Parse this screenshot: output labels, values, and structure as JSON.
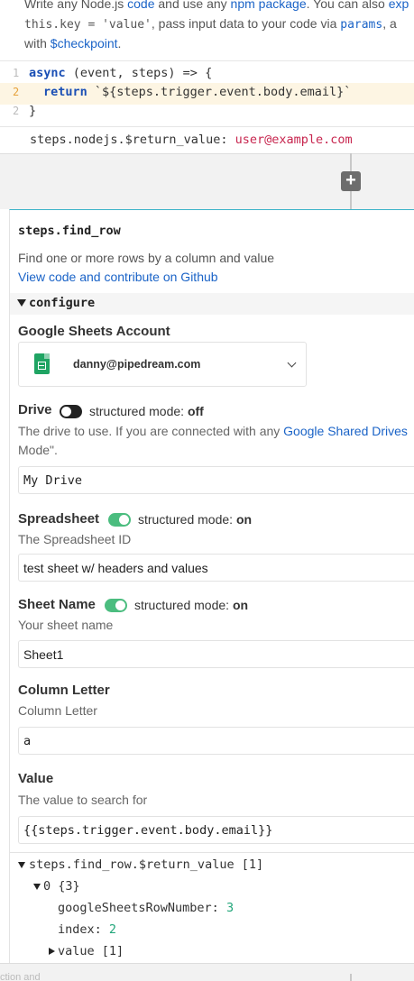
{
  "top_description": {
    "line1_part1": "Write any Node.js ",
    "line1_link1": "code",
    "line1_part2": " and use any ",
    "line1_link2": "npm package",
    "line1_part3": ". You can also ",
    "line1_link3": "exp",
    "line2_code1": "this.key = 'value'",
    "line2_part1": ", pass input data to your code via ",
    "line2_link1": "params",
    "line2_part2": ", a",
    "line3_part1": "with ",
    "line3_link1": "$checkpoint",
    "line3_part2": "."
  },
  "editor": {
    "line_numbers": [
      "1",
      "2",
      "2"
    ],
    "line1_kw": "async",
    "line1_rest": " (event, steps) => {",
    "line2_kw": "return",
    "line2_rest": " `${steps.trigger.event.body.email}`",
    "line3": "}"
  },
  "previous_return": {
    "label": "steps.nodejs.$return_value: ",
    "value": "user@example.com"
  },
  "add_step_symbol": "+",
  "step": {
    "title": "steps.find_row",
    "description": "Find one or more rows by a column and value",
    "github_link": "View code and contribute on Github",
    "configure_label": "configure",
    "account": {
      "label": "Google Sheets Account",
      "email": "danny@pipedream.com"
    },
    "drive": {
      "label": "Drive",
      "mode_prefix": "structured mode: ",
      "mode_value": "off",
      "desc_part1": "The drive to use. If you are connected with any ",
      "desc_link": "Google Shared Drives",
      "desc_line2": "Mode\".",
      "value": "My Drive"
    },
    "spreadsheet": {
      "label": "Spreadsheet",
      "mode_prefix": "structured mode: ",
      "mode_value": "on",
      "desc": "The Spreadsheet ID",
      "value": "test sheet w/ headers and values"
    },
    "sheet_name": {
      "label": "Sheet Name",
      "mode_prefix": "structured mode: ",
      "mode_value": "on",
      "desc": "Your sheet name",
      "value": "Sheet1"
    },
    "column": {
      "label": "Column Letter",
      "desc": "Column Letter",
      "value": "a"
    },
    "value_field": {
      "label": "Value",
      "desc": "The value to search for",
      "value": "{{steps.trigger.event.body.email}}"
    },
    "output": {
      "root": "steps.find_row.$return_value [1]",
      "item0": "0 {3}",
      "row_number_key": "googleSheetsRowNumber: ",
      "row_number_val": "3",
      "index_key": "index: ",
      "index_val": "2",
      "value_key": "value [1]"
    }
  },
  "bottom_faint_text": "ction and",
  "colors": {
    "link": "#1a63c7",
    "toggle_on": "#4bbd7f",
    "step_border": "#3cb4c9",
    "number": "#21a67a",
    "string_red": "#c7254e"
  }
}
